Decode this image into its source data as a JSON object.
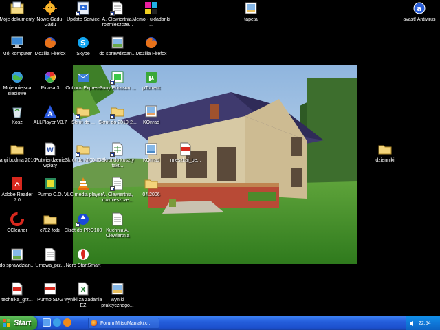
{
  "desktop": {
    "icons": [
      {
        "label": "Moje dokumenty",
        "icon": "my-documents-icon"
      },
      {
        "label": "Nowe Gadu-Gadu",
        "icon": "gadu-gadu-icon"
      },
      {
        "label": "Update Service",
        "icon": "update-service-icon"
      },
      {
        "label": "A. Clewiertnia, rozmieszcze...",
        "icon": "document-icon"
      },
      {
        "label": "Memo - układanki ...",
        "icon": "memo-game-icon"
      },
      {
        "label": "tapeta",
        "icon": "image-icon"
      },
      {
        "label": "avast! Antivirus",
        "icon": "avast-icon"
      },
      {
        "label": "Mój komputer",
        "icon": "my-computer-icon"
      },
      {
        "label": "Mozilla Firefox",
        "icon": "firefox-icon"
      },
      {
        "label": "Skype",
        "icon": "skype-icon"
      },
      {
        "label": "do sprawdzoan...",
        "icon": "image-icon"
      },
      {
        "label": "Mozilla Firefox",
        "icon": "firefox-icon"
      },
      {
        "label": "Moje miejsca sieciowe",
        "icon": "network-places-icon"
      },
      {
        "label": "Picasa 3",
        "icon": "picasa-icon"
      },
      {
        "label": "Outlook Express",
        "icon": "outlook-express-icon"
      },
      {
        "label": "Sony Ericsson ...",
        "icon": "sony-ericsson-icon"
      },
      {
        "label": "μTorrent",
        "icon": "utorrent-icon"
      },
      {
        "label": "Kosz",
        "icon": "recycle-bin-icon"
      },
      {
        "label": "ALLPlayer V3.7",
        "icon": "allplayer-icon"
      },
      {
        "label": "Skrót do ...",
        "icon": "folder-shortcut-icon"
      },
      {
        "label": "Skrót do 2010-2...",
        "icon": "folder-shortcut-icon"
      },
      {
        "label": "KOnrad",
        "icon": "image-icon"
      },
      {
        "label": "targi budma 2010",
        "icon": "folder-icon"
      },
      {
        "label": "Potwierdzenie wpłaty",
        "icon": "word-document-icon"
      },
      {
        "label": "Skrót do MIOXIO",
        "icon": "folder-shortcut-icon"
      },
      {
        "label": "Skrót do koszty fakt...",
        "icon": "spreadsheet-shortcut-icon"
      },
      {
        "label": "KOnrad",
        "icon": "image-icon"
      },
      {
        "label": "mieszkai_be...",
        "icon": "pdf-icon"
      },
      {
        "label": "dzienniki",
        "icon": "folder-icon"
      },
      {
        "label": "Adobe Reader 7.0",
        "icon": "adobe-reader-icon"
      },
      {
        "label": "Purmo C.O.",
        "icon": "purmo-icon"
      },
      {
        "label": "VLC media player",
        "icon": "vlc-icon"
      },
      {
        "label": "A. Clewiertnia, rozmieszcze...",
        "icon": "document-icon"
      },
      {
        "label": "04.2006",
        "icon": "folder-icon"
      },
      {
        "label": "CCleaner",
        "icon": "ccleaner-icon"
      },
      {
        "label": "c702 fotki",
        "icon": "folder-icon"
      },
      {
        "label": "Skrót do PRO100",
        "icon": "pro100-shortcut-icon"
      },
      {
        "label": "Kuchnia A. Clewiertnia",
        "icon": "document-icon"
      },
      {
        "label": "do sprawdzian...",
        "icon": "image-icon"
      },
      {
        "label": "Umowa_prz...",
        "icon": "word-document-icon"
      },
      {
        "label": "Nero StartSmart",
        "icon": "nero-icon"
      },
      {
        "label": "technika_grz...",
        "icon": "pdf-icon"
      },
      {
        "label": "Purmo SDG",
        "icon": "purmo-sdg-icon"
      },
      {
        "label": "wyniki za zadania EZ",
        "icon": "excel-icon"
      },
      {
        "label": "wyniki praktycznego...",
        "icon": "image-icon"
      }
    ]
  },
  "taskbar": {
    "start_label": "Start",
    "task_label": "Forum MitsuManiaki.c...",
    "clock": "22:54"
  },
  "colors": {
    "taskbar": "#245edb",
    "start_button": "#3c9a36",
    "tray": "#0f77d8",
    "desktop_bg": "#000000"
  }
}
